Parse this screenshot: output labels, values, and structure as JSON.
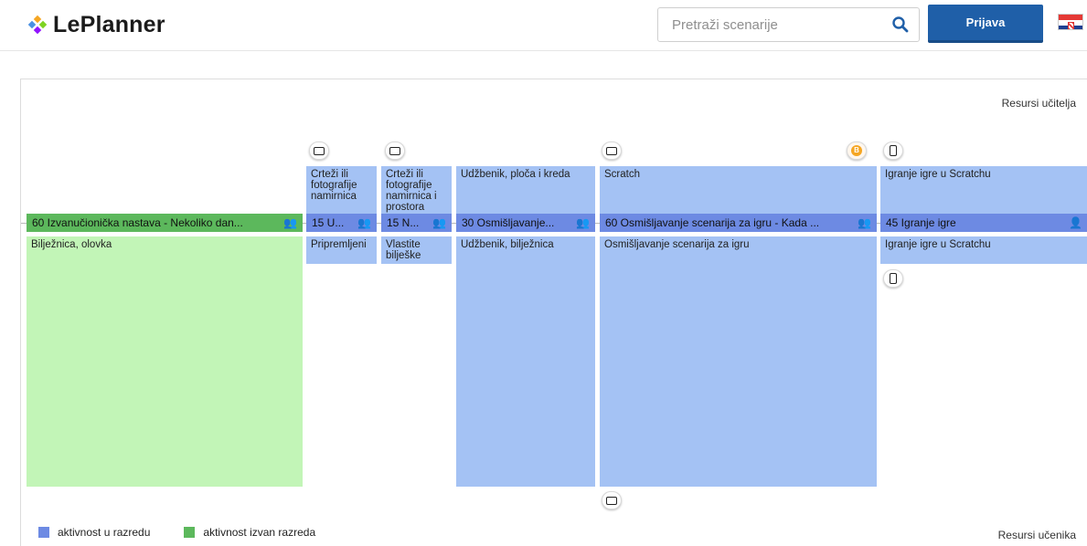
{
  "header": {
    "logo_text": "LePlanner",
    "search_placeholder": "Pretraži scenarije",
    "login_label": "Prijava",
    "search_icon": "search-icon",
    "flag_icon": "croatia-flag-icon"
  },
  "timeline": {
    "teacher_resources_label": "Resursi učitelja",
    "student_resources_label": "Resursi učenika",
    "activities": [
      {
        "bar": "60 Izvanučionička nastava - Nekoliko dan...",
        "student_text": "Bilježnica, olovka",
        "teacher_text": "",
        "type": "outside",
        "group_icon": "group-icon"
      },
      {
        "bar": "15 U...",
        "teacher_text": "Crteži ili fotografije namirnica",
        "student_text": "Pripremljeni",
        "type": "class",
        "group_icon": "group-icon"
      },
      {
        "bar": "15 N...",
        "teacher_text": "Crteži ili fotografije namirnica i prostora",
        "student_text": "Vlastite bilješke",
        "type": "class",
        "group_icon": "group-icon"
      },
      {
        "bar": "30 Osmišljavanje...",
        "teacher_text": "Udžbenik, ploča i kreda",
        "student_text": "Udžbenik, bilježnica",
        "type": "class",
        "group_icon": "group-icon"
      },
      {
        "bar": "60 Osmišljavanje scenarija za igru - Kada ...",
        "teacher_text": "Scratch",
        "student_text": "Osmišljavanje scenarija za igru",
        "type": "class",
        "group_icon": "group-icon"
      },
      {
        "bar": "45 Igranje igre",
        "teacher_text": "Igranje igre u Scratchu",
        "student_text": "Igranje igre u Scratchu",
        "type": "class",
        "group_icon": "person-icon"
      }
    ]
  },
  "legend": {
    "in_class": {
      "label": "aktivnost u razredu",
      "color": "#6d8ae3"
    },
    "outside_class": {
      "label": "aktivnost izvan razreda",
      "color": "#5cb85c"
    }
  },
  "colors": {
    "accent": "#1f5fa8",
    "class_activity_box": "#a4c2f4",
    "outside_activity_area": "#c2f5b7"
  }
}
